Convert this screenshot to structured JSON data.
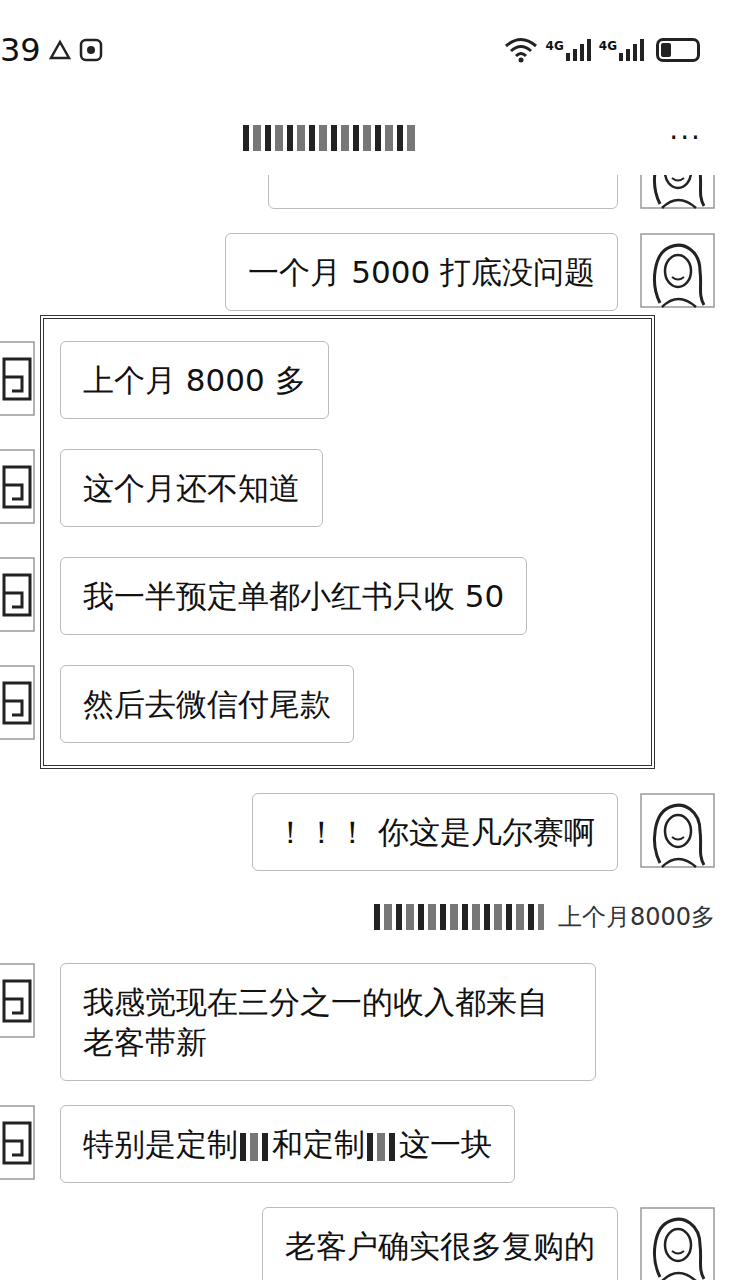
{
  "status_bar": {
    "time": "39",
    "networks": [
      "4G",
      "4G"
    ],
    "battery_level": 0.3
  },
  "header": {
    "title_redacted": true,
    "menu": "···"
  },
  "messages": [
    {
      "side": "right",
      "kind": "cut"
    },
    {
      "side": "right",
      "kind": "text",
      "text": "一个月 5000 打底没问题"
    },
    {
      "side": "left",
      "kind": "selection",
      "items": [
        "上个月 8000 多",
        "这个月还不知道",
        "我一半预定单都小红书只收 50",
        "然后去微信付尾款"
      ]
    },
    {
      "side": "right",
      "kind": "text",
      "text": "！！！ 你这是凡尔赛啊"
    },
    {
      "side": "right",
      "kind": "quote",
      "text": "上个月8000多"
    },
    {
      "side": "left",
      "kind": "text",
      "text": "我感觉现在三分之一的收入都来自老客带新"
    },
    {
      "side": "left",
      "kind": "redacted",
      "segments": [
        "特别是定制",
        "和定制",
        "这一块"
      ]
    },
    {
      "side": "right",
      "kind": "text",
      "text": "老客户确实很多复购的"
    }
  ]
}
